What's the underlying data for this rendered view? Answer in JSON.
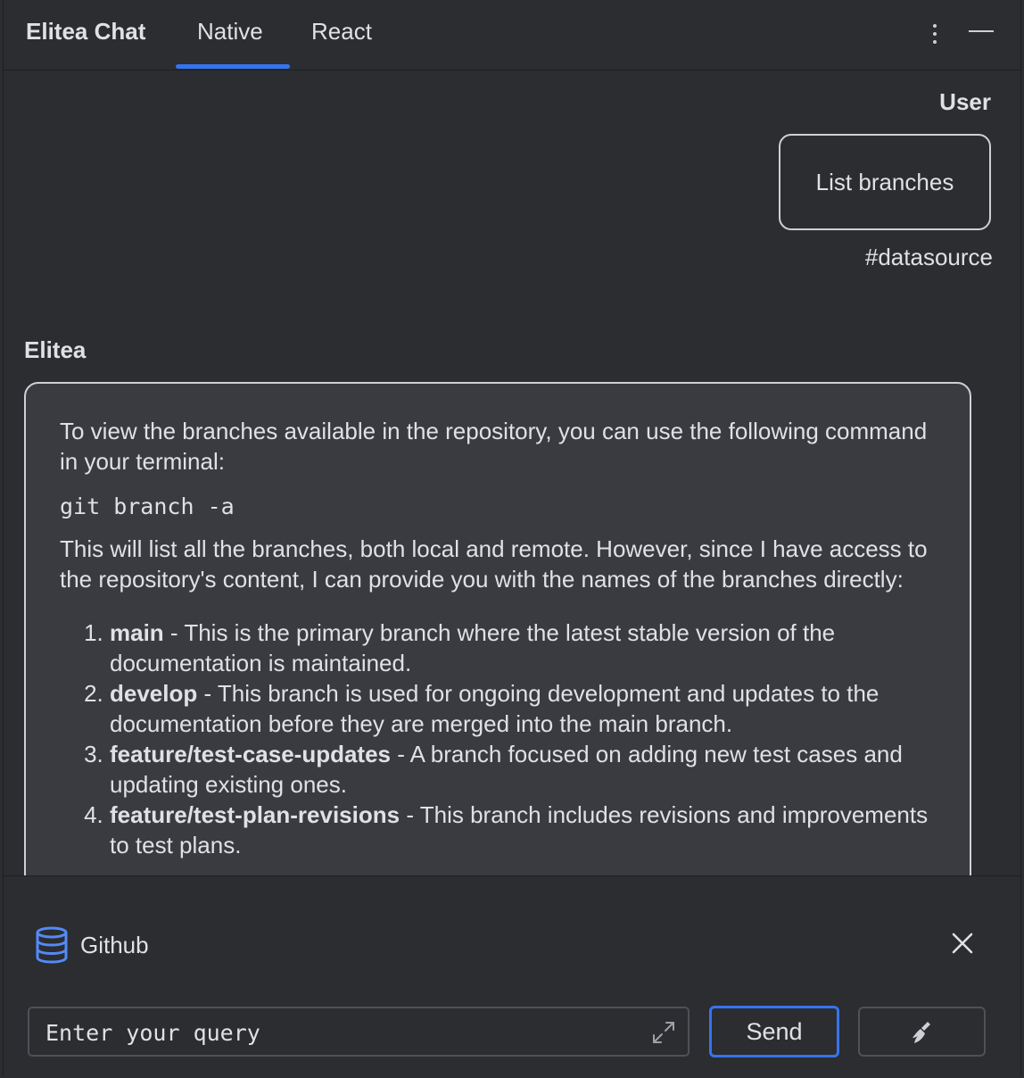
{
  "header": {
    "app_title": "Elitea Chat",
    "tabs": [
      {
        "label": "Native",
        "active": true
      },
      {
        "label": "React",
        "active": false
      }
    ],
    "more_icon": "vertical-dots-icon",
    "minimize_icon": "minimize-icon"
  },
  "chat": {
    "user": {
      "label": "User",
      "message": "List branches",
      "tag": "#datasource"
    },
    "bot": {
      "label": "Elitea",
      "intro": "To view the branches available in the repository, you can use the following command in your terminal:",
      "command": "git branch -a",
      "explanation": "This will list all the branches, both local and remote. However, since I have access to the repository's content, I can provide you with the names of the branches directly:",
      "branches": [
        {
          "name": "main",
          "description": " - This is the primary branch where the latest stable version of the documentation is maintained."
        },
        {
          "name": "develop",
          "description": " - This branch is used for ongoing development and updates to the documentation before they are merged into the main branch."
        },
        {
          "name": "feature/test-case-updates",
          "description": " - A branch focused on adding new test cases and updating existing ones."
        },
        {
          "name": "feature/test-plan-revisions",
          "description": " - This branch includes revisions and improvements to test plans."
        }
      ]
    }
  },
  "datasource": {
    "name": "Github",
    "icon": "database-icon",
    "close_icon": "close-icon"
  },
  "input": {
    "placeholder": "Enter your query",
    "value": "",
    "expand_icon": "expand-icon"
  },
  "buttons": {
    "send_label": "Send",
    "clear_icon": "broom-icon"
  },
  "colors": {
    "background": "#2b2d30",
    "bubble": "#393b40",
    "accent": "#3574f0",
    "text": "#dfe1e5"
  }
}
